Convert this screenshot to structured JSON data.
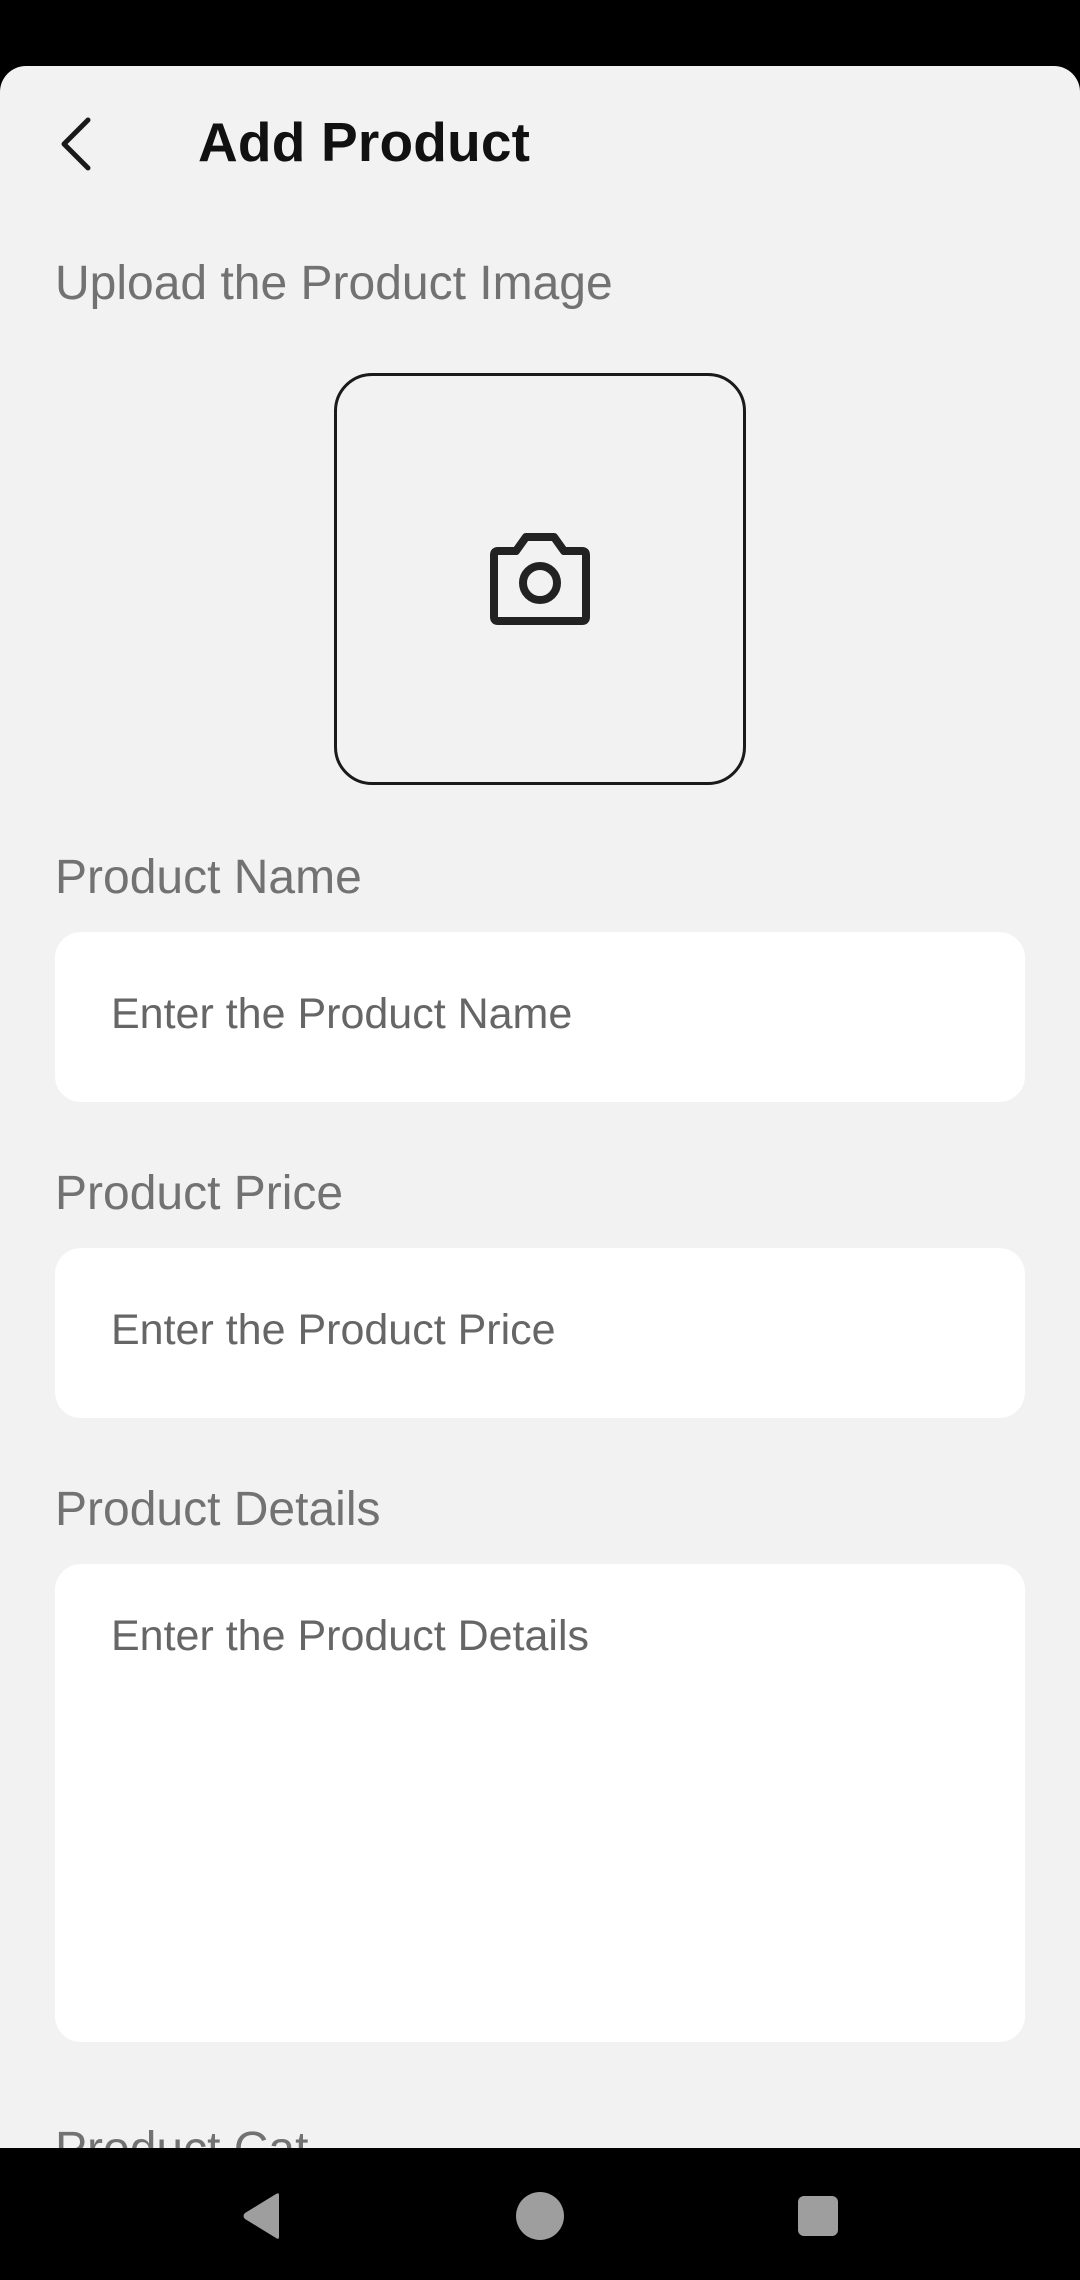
{
  "header": {
    "title": "Add Product",
    "back_icon": "chevron-left-icon"
  },
  "upload": {
    "label": "Upload the Product Image",
    "icon": "camera-icon"
  },
  "product_name": {
    "label": "Product Name",
    "placeholder": "Enter the Product Name"
  },
  "product_price": {
    "label": "Product Price",
    "placeholder": "Enter the Product Price"
  },
  "product_details": {
    "label": "Product Details",
    "placeholder": "Enter the Product Details"
  },
  "next_section": {
    "label_partial": "Product Cat"
  },
  "nav": {
    "back_icon": "triangle-back-icon",
    "home_icon": "circle-home-icon",
    "recents_icon": "square-recents-icon"
  },
  "colors": {
    "background": "#f2f2f2",
    "field": "#ffffff",
    "label": "#727272",
    "title": "#111111"
  }
}
